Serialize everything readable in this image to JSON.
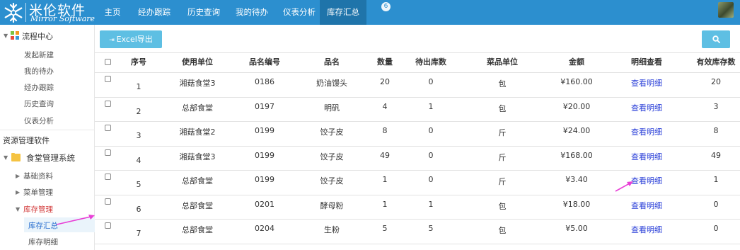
{
  "app": {
    "logo_cn": "米伦软件",
    "logo_en": "Mirror Software",
    "nav": [
      "主页",
      "经办跟踪",
      "历史查询",
      "我的待办",
      "仪表分析",
      "库存汇总"
    ],
    "nav_badge": "6"
  },
  "sidebar": {
    "flow_center": "流程中心",
    "flow_items": [
      "发起新建",
      "我的待办",
      "经办跟踪",
      "历史查询",
      "仪表分析"
    ],
    "resource_title": "资源管理软件",
    "canteen_system": "食堂管理系统",
    "sections": [
      "基础资料",
      "菜单管理",
      "库存管理"
    ],
    "inventory_items": [
      "库存汇总",
      "库存明细"
    ]
  },
  "toolbar": {
    "excel_label": "Excel导出"
  },
  "table": {
    "headers": [
      "序号",
      "使用单位",
      "品名编号",
      "品名",
      "数量",
      "待出库数",
      "菜品单位",
      "金额",
      "明细查看",
      "有效库存数"
    ],
    "rows": [
      {
        "no": "1",
        "unit": "湘菇食堂3",
        "code": "0186",
        "name": "奶油馒头",
        "qty": "20",
        "pending": "0",
        "measure": "包",
        "amount": "¥160.00",
        "detail": "查看明细",
        "stock": "20"
      },
      {
        "no": "2",
        "unit": "总部食堂",
        "code": "0197",
        "name": "明矾",
        "qty": "4",
        "pending": "1",
        "measure": "包",
        "amount": "¥20.00",
        "detail": "查看明细",
        "stock": "3"
      },
      {
        "no": "3",
        "unit": "湘菇食堂2",
        "code": "0199",
        "name": "饺子皮",
        "qty": "8",
        "pending": "0",
        "measure": "斤",
        "amount": "¥24.00",
        "detail": "查看明细",
        "stock": "8"
      },
      {
        "no": "4",
        "unit": "湘菇食堂3",
        "code": "0199",
        "name": "饺子皮",
        "qty": "49",
        "pending": "0",
        "measure": "斤",
        "amount": "¥168.00",
        "detail": "查看明细",
        "stock": "49"
      },
      {
        "no": "5",
        "unit": "总部食堂",
        "code": "0199",
        "name": "饺子皮",
        "qty": "1",
        "pending": "0",
        "measure": "斤",
        "amount": "¥3.40",
        "detail": "查看明细",
        "stock": "1"
      },
      {
        "no": "6",
        "unit": "总部食堂",
        "code": "0201",
        "name": "酵母粉",
        "qty": "1",
        "pending": "1",
        "measure": "包",
        "amount": "¥18.00",
        "detail": "查看明细",
        "stock": "0"
      },
      {
        "no": "7",
        "unit": "总部食堂",
        "code": "0204",
        "name": "生粉",
        "qty": "5",
        "pending": "5",
        "measure": "包",
        "amount": "¥5.00",
        "detail": "查看明细",
        "stock": "0"
      }
    ]
  },
  "colors": {
    "topbar": "#2c8fcf",
    "nav_active": "#1f74aa",
    "button": "#5ebfe3",
    "link": "#2a3fd8",
    "annotation_arrow": "#e83fd6"
  }
}
